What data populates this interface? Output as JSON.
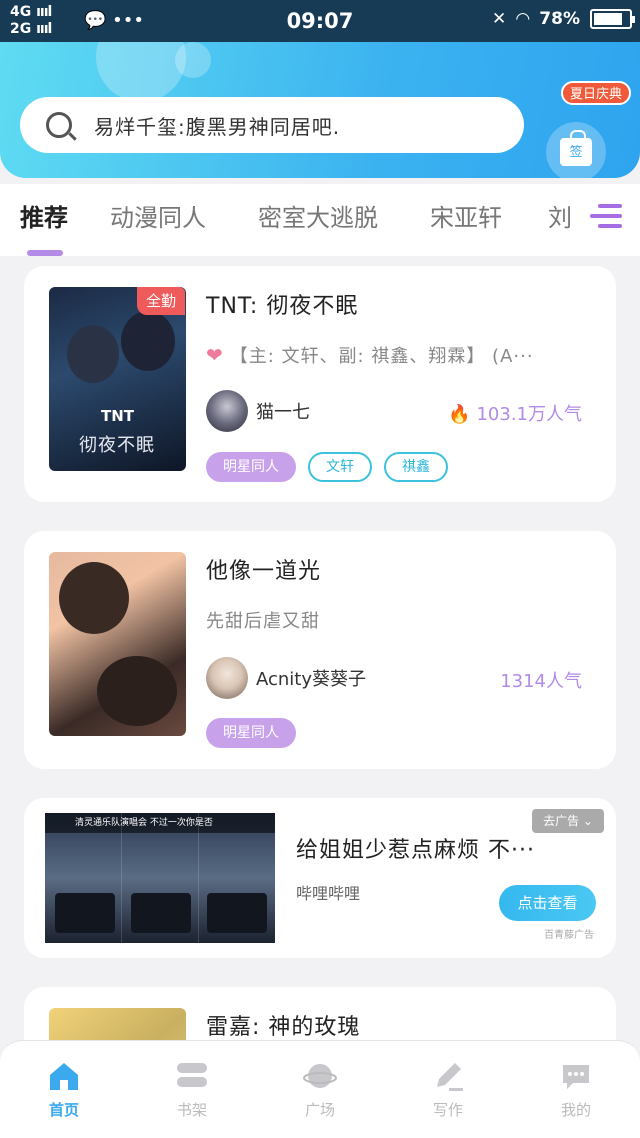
{
  "status_bar": {
    "network_1": "4G",
    "network_2": "2G",
    "time": "09:07",
    "battery": "78%",
    "dots": "• ••"
  },
  "header": {
    "search_placeholder": "易烊千玺:腹黑男神同居吧.",
    "summer_badge": "夏日庆典",
    "gift_label": "签"
  },
  "tabs": [
    {
      "label": "推荐",
      "active": true
    },
    {
      "label": "动漫同人",
      "active": false
    },
    {
      "label": "密室大逃脱",
      "active": false
    },
    {
      "label": "宋亚轩",
      "active": false
    },
    {
      "label": "刘",
      "active": false
    }
  ],
  "books": [
    {
      "title": "TNT: 彻夜不眠",
      "badge": "全勤",
      "cover_text": "彻夜不眠",
      "cover_brand": "TNT",
      "desc": "【主: 文轩、副: 祺鑫、翔霖】 (A···",
      "author": "猫一七",
      "popularity": "103.1万人气",
      "tags": [
        "明星同人",
        "文轩",
        "祺鑫"
      ]
    },
    {
      "title": "他像一道光",
      "desc": "先甜后虐又甜",
      "author": "Acnity葵葵子",
      "popularity": "1314人气",
      "tags": [
        "明星同人"
      ]
    },
    {
      "title": "雷嘉: 神的玫瑰"
    }
  ],
  "ad": {
    "title": "给姐姐少惹点麻烦 不···",
    "source": "哔哩哔哩",
    "button": "点击查看",
    "close": "去广告 ⌄",
    "mark": "百青藤广告",
    "image_caption": "清灵通乐队演唱会 不过一次你是否"
  },
  "bottom_nav": [
    {
      "label": "首页",
      "icon": "home-icon",
      "active": true
    },
    {
      "label": "书架",
      "icon": "bookshelf-icon",
      "active": false
    },
    {
      "label": "广场",
      "icon": "planet-icon",
      "active": false
    },
    {
      "label": "写作",
      "icon": "pen-icon",
      "active": false
    },
    {
      "label": "我的",
      "icon": "chat-bubble-icon",
      "active": false
    }
  ],
  "colors": {
    "accent": "#3aa9ee",
    "tab_underline": "#b58be8",
    "tag_purple": "#c7a2ea",
    "tag_cyan": "#3cc2dc",
    "badge_red": "#ef5a5a"
  }
}
